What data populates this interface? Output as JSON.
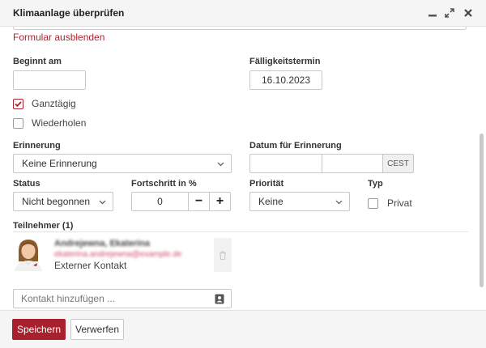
{
  "window": {
    "title": "Klimaanlage überprüfen",
    "minimize_icon": "minimize-icon",
    "maximize_icon": "expand-icon",
    "close_icon": "close-icon"
  },
  "form": {
    "toggle_link": "Formular ausblenden",
    "start": {
      "label": "Beginnt am",
      "value": ""
    },
    "due": {
      "label": "Fälligkeitstermin",
      "value": "16.10.2023"
    },
    "all_day": {
      "label": "Ganztägig",
      "checked": true
    },
    "repeat": {
      "label": "Wiederholen",
      "checked": false
    },
    "reminder": {
      "label": "Erinnerung",
      "value": "Keine Erinnerung"
    },
    "reminder_date": {
      "label": "Datum für Erinnerung",
      "date": "",
      "time": "",
      "timezone": "CEST"
    },
    "status": {
      "label": "Status",
      "value": "Nicht begonnen"
    },
    "progress": {
      "label": "Fortschritt in %",
      "value": "0",
      "minus": "−",
      "plus": "+"
    },
    "priority": {
      "label": "Priorität",
      "value": "Keine"
    },
    "type": {
      "label": "Typ",
      "private_label": "Privat",
      "checked": false
    }
  },
  "participants": {
    "header": "Teilnehmer (1)",
    "items": [
      {
        "name": "Andrejewna, Ekaterina",
        "email": "ekaterina.andrejewna@example.de",
        "type": "Externer Kontakt"
      }
    ],
    "add_placeholder": "Kontakt hinzufügen ..."
  },
  "footer": {
    "save": "Speichern",
    "discard": "Verwerfen"
  },
  "colors": {
    "accent": "#a8202d"
  }
}
